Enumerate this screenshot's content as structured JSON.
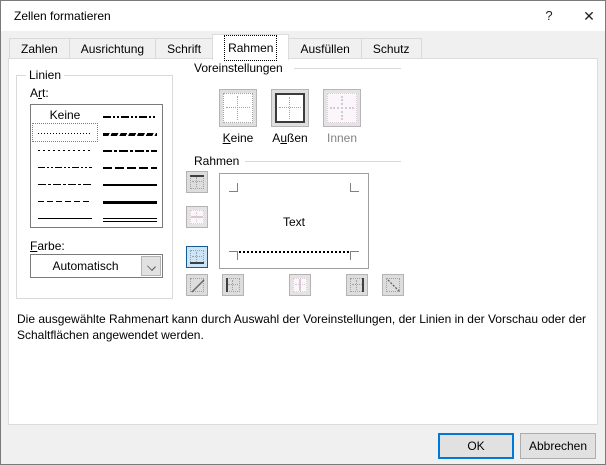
{
  "window": {
    "title": "Zellen formatieren",
    "help_glyph": "?",
    "close_glyph": "✕"
  },
  "tabs": [
    {
      "label": "Zahlen",
      "selected": false
    },
    {
      "label": "Ausrichtung",
      "selected": false
    },
    {
      "label": "Schrift",
      "selected": false
    },
    {
      "label": "Rahmen",
      "selected": true
    },
    {
      "label": "Ausfüllen",
      "selected": false
    },
    {
      "label": "Schutz",
      "selected": false
    }
  ],
  "linien": {
    "group_label": "Linien",
    "art_label": {
      "pre": "A",
      "key": "r",
      "post": "t:"
    },
    "none_item": "Keine",
    "selected_style": "dotted-fine",
    "styles_left": [
      "none",
      "dotted-fine",
      "dotted",
      "dash-dot-dot",
      "dash-dot",
      "dashed",
      "solid-thin"
    ],
    "styles_right": [
      "medium-dash-dot-dot",
      "slanted-dash-dot",
      "medium-dash-dot",
      "medium-dashed",
      "solid-medium",
      "solid-thick",
      "double"
    ],
    "farbe_label": {
      "key": "F",
      "post": "arbe:"
    },
    "farbe_value": "Automatisch"
  },
  "voreinstellungen": {
    "group_label": "Voreinstellungen",
    "presets": [
      {
        "label_pre": "",
        "label_key": "K",
        "label_post": "eine",
        "disabled": false
      },
      {
        "label_pre": "A",
        "label_key": "u",
        "label_post": "ßen",
        "disabled": false
      },
      {
        "label_pre": "",
        "label_key": "",
        "label_post": "Innen",
        "disabled": true
      }
    ]
  },
  "rahmen": {
    "group_label": "Rahmen",
    "preview_text": "Text",
    "applied_border": "bottom-dotted",
    "buttons": [
      "top",
      "inner-horizontal",
      "bottom",
      "diagonal-up",
      "left",
      "inner-vertical",
      "right",
      "diagonal-down"
    ],
    "selected_button": "bottom"
  },
  "description": "Die ausgewählte Rahmenart kann durch Auswahl der Voreinstellungen, der Linien in der Vorschau oder der Schaltflächen angewendet werden.",
  "footer": {
    "ok_label": "OK",
    "cancel_label": "Abbrechen"
  },
  "colors": {
    "accent": "#0078d7",
    "selected_button_border": "#155a93",
    "selected_button_bg": "#cce4f7",
    "dialog_bg": "#f0f0f0"
  }
}
